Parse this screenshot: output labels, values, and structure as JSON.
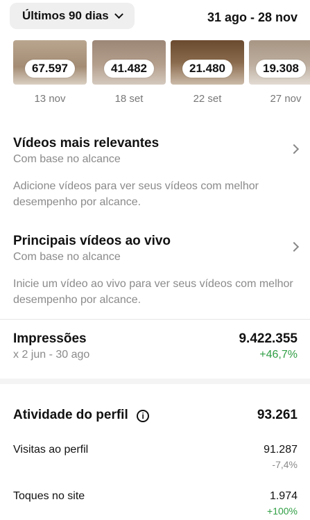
{
  "header": {
    "range_label": "Últimos 90 dias",
    "date_range": "31 ago - 28 nov"
  },
  "thumbnails": [
    {
      "count": "67.597",
      "date": "13 nov"
    },
    {
      "count": "41.482",
      "date": "18 set"
    },
    {
      "count": "21.480",
      "date": "22 set"
    },
    {
      "count": "19.308",
      "date": "27 nov"
    }
  ],
  "top_videos": {
    "title": "Vídeos mais relevantes",
    "subtitle": "Com base no alcance",
    "description": "Adicione vídeos para ver seus vídeos com melhor desempenho por alcance."
  },
  "live_videos": {
    "title": "Principais vídeos ao vivo",
    "subtitle": "Com base no alcance",
    "description": "Inicie um vídeo ao vivo para ver seus vídeos com melhor desempenho por alcance."
  },
  "impressions": {
    "label": "Impressões",
    "value": "9.422.355",
    "compare": "x 2 jun - 30 ago",
    "change": "+46,7%"
  },
  "profile_activity": {
    "title": "Atividade do perfil",
    "total": "93.261",
    "rows": [
      {
        "label": "Visitas ao perfil",
        "value": "91.287",
        "change": "-7,4%"
      },
      {
        "label": "Toques no site",
        "value": "1.974",
        "change": "+100%"
      }
    ]
  }
}
